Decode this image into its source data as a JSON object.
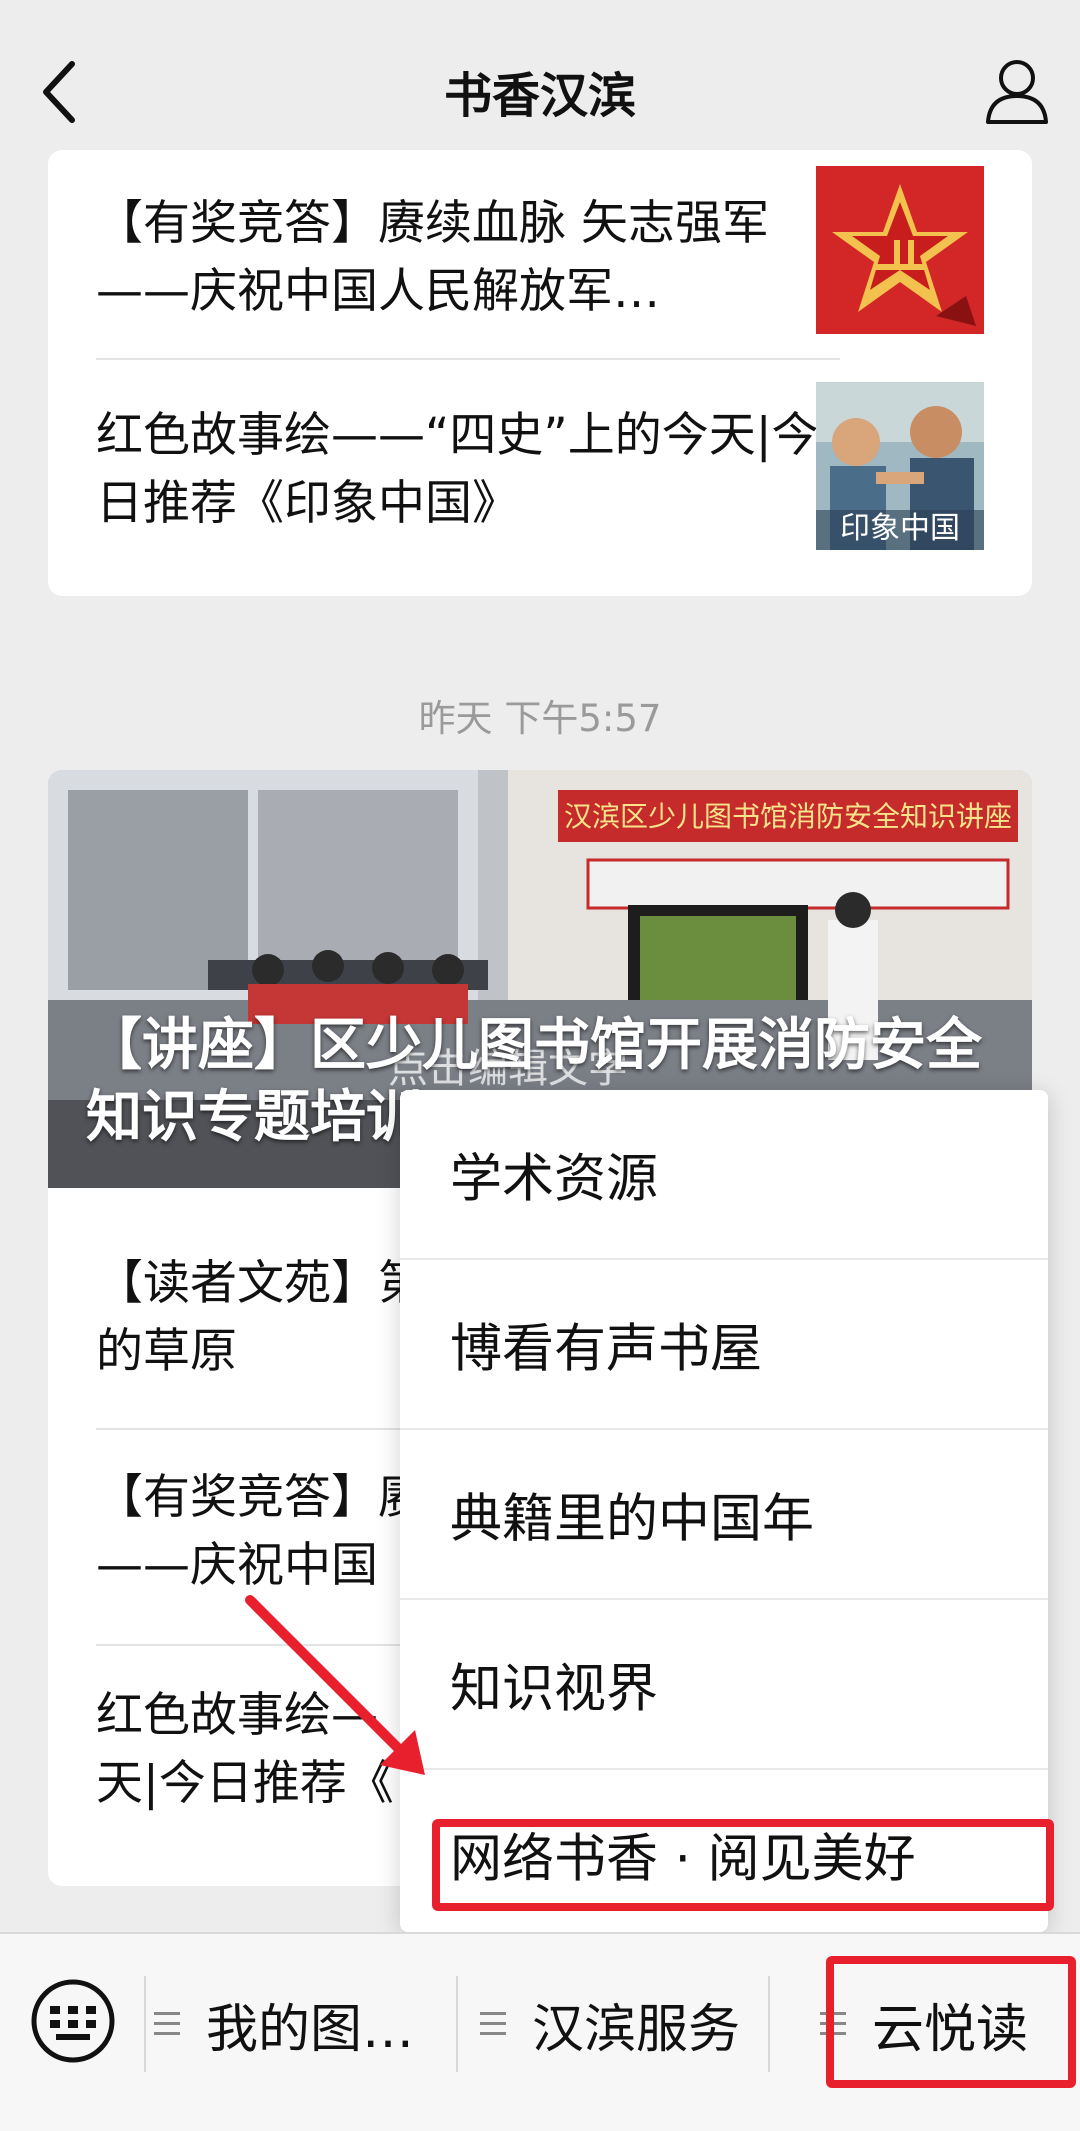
{
  "nav": {
    "title": "书香汉滨"
  },
  "card1": {
    "articles": [
      {
        "title": "【有奖竞答】赓续血脉 矢志强军——庆祝中国人民解放军…"
      },
      {
        "title": "红色故事绘——“四史”上的今天|今日推荐《印象中国》"
      }
    ]
  },
  "timestamp": "昨天 下午5:57",
  "card2": {
    "hero_title": "【讲座】区少儿图书馆开展消防安全知识专题培训",
    "hero_banner": "汉滨区少儿图书馆消防安全知识讲座",
    "hero_overlay": "点击编辑文字",
    "thumb_text": "印象中国",
    "articles": [
      {
        "title": "【读者文苑】第",
        "line2": "的草原"
      },
      {
        "title": "【有奖竞答】赓",
        "line2": "——庆祝中国"
      },
      {
        "title": "红色故事绘—",
        "line2": "天|今日推荐《"
      }
    ]
  },
  "menu": {
    "items": [
      {
        "label": "学术资源"
      },
      {
        "label": "博看有声书屋"
      },
      {
        "label": "典籍里的中国年"
      },
      {
        "label": "知识视界"
      },
      {
        "label": "网络书香 · 阅见美好"
      }
    ]
  },
  "bottom_tabs": [
    {
      "label": "我的图…"
    },
    {
      "label": "汉滨服务"
    },
    {
      "label": "云悦读"
    }
  ],
  "colors": {
    "highlight": "#e8202e",
    "background": "#ededed"
  }
}
